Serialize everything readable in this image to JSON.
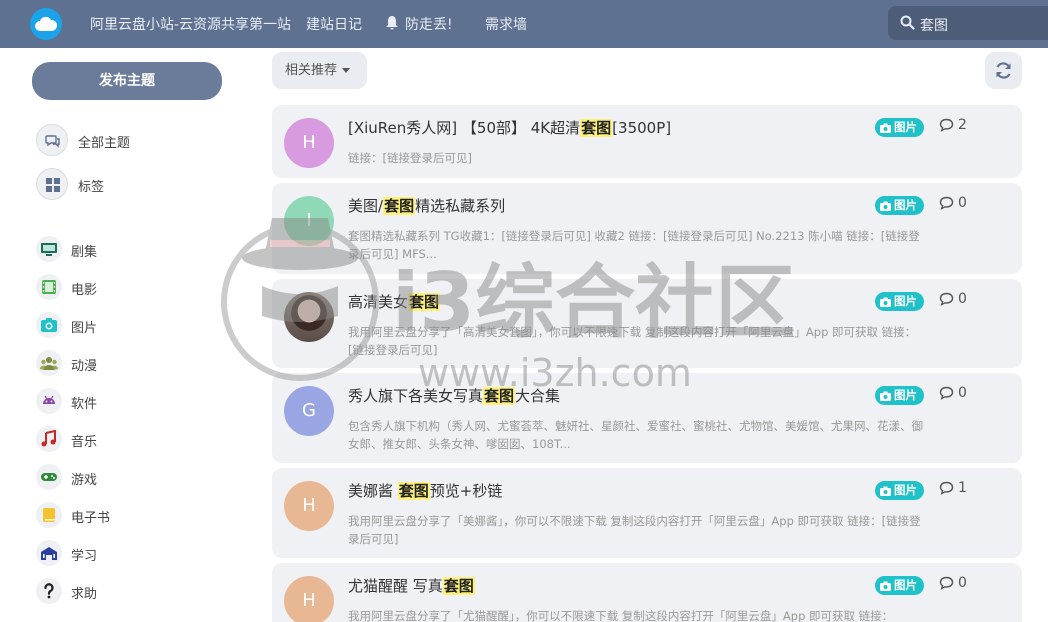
{
  "header": {
    "nav": [
      {
        "label": "阿里云盘小站-云资源共享第一站"
      },
      {
        "label": "建站日记"
      },
      {
        "label": "防走丢!"
      },
      {
        "label": "需求墙"
      }
    ],
    "search_value": "套图",
    "bg_color": "#5f7190"
  },
  "sidebar": {
    "publish_label": "发布主题",
    "main_items": [
      {
        "label": "全部主题",
        "icon": "chat-icon"
      },
      {
        "label": "标签",
        "icon": "grid-icon"
      }
    ],
    "tags": [
      {
        "label": "剧集",
        "icon": "tv-icon",
        "color": "#1e6b5a"
      },
      {
        "label": "电影",
        "icon": "film-icon",
        "color": "#4caf50"
      },
      {
        "label": "图片",
        "icon": "camera-icon",
        "color": "#20c2c9"
      },
      {
        "label": "动漫",
        "icon": "users-icon",
        "color": "#7d8b3e"
      },
      {
        "label": "软件",
        "icon": "android-icon",
        "color": "#8e3fa8"
      },
      {
        "label": "音乐",
        "icon": "music-icon",
        "color": "#c62828"
      },
      {
        "label": "游戏",
        "icon": "gamepad-icon",
        "color": "#2e8b3a"
      },
      {
        "label": "电子书",
        "icon": "book-icon",
        "color": "#f4c430"
      },
      {
        "label": "学习",
        "icon": "school-icon",
        "color": "#2a3e9c"
      },
      {
        "label": "求助",
        "icon": "question-icon",
        "color": "#222222"
      }
    ]
  },
  "toolbar": {
    "sort_label": "相关推荐"
  },
  "discussions": [
    {
      "avatar": "H",
      "avatar_color": "#d99be0",
      "title_pre": "[XiuRen秀人网] 【50部】 4K超清",
      "title_hl": "套图",
      "title_post": "[3500P]",
      "excerpt": "链接：[链接登录后可见]",
      "tag": "图片",
      "comments": "2"
    },
    {
      "avatar": "I",
      "avatar_color": "#8fd9b6",
      "title_pre": "美图/",
      "title_hl": "套图",
      "title_post": "精选私藏系列",
      "excerpt": "套图精选私藏系列 TG收藏1：[链接登录后可见] 收藏2 链接：[链接登录后可见] No.2213 陈小喵 链接：[链接登录后可见] MFS...",
      "tag": "图片",
      "comments": "0"
    },
    {
      "avatar": "",
      "avatar_color": "#5a4c47",
      "title_pre": "高清美女",
      "title_hl": "套图",
      "title_post": "",
      "excerpt": "我用阿里云盘分享了「高清美女套图」，你可以不限速下载 复制这段内容打开「阿里云盘」App 即可获取 链接：[链接登录后可见]",
      "tag": "图片",
      "comments": "0"
    },
    {
      "avatar": "G",
      "avatar_color": "#9aa6e3",
      "title_pre": "秀人旗下各美女写真",
      "title_hl": "套图",
      "title_post": "大合集",
      "excerpt": "包含秀人旗下机构（秀人网、尤蜜荟萃、魅妍社、星颜社、爱蜜社、蜜桃社、尤物馆、美媛馆、尤果网、花漾、御女郎、推女郎、头条女神、嗲囡囡、108T...",
      "tag": "图片",
      "comments": "0"
    },
    {
      "avatar": "H",
      "avatar_color": "#e8b894",
      "title_pre": "美娜酱 ",
      "title_hl": "套图",
      "title_post": "预览+秒链",
      "excerpt": "我用阿里云盘分享了「美娜酱」，你可以不限速下载 复制这段内容打开「阿里云盘」App 即可获取 链接：[链接登录后可见]",
      "tag": "图片",
      "comments": "1"
    },
    {
      "avatar": "H",
      "avatar_color": "#e8b894",
      "title_pre": "尤猫醒醒 写真",
      "title_hl": "套图",
      "title_post": "",
      "excerpt": "我用阿里云盘分享了「尤猫醒醒」，你可以不限速下载 复制这段内容打开「阿里云盘」App 即可获取 链接：",
      "tag": "图片",
      "comments": "0"
    }
  ],
  "watermark": {
    "text": "i3综合社区",
    "url": "www.i3zh.com"
  }
}
